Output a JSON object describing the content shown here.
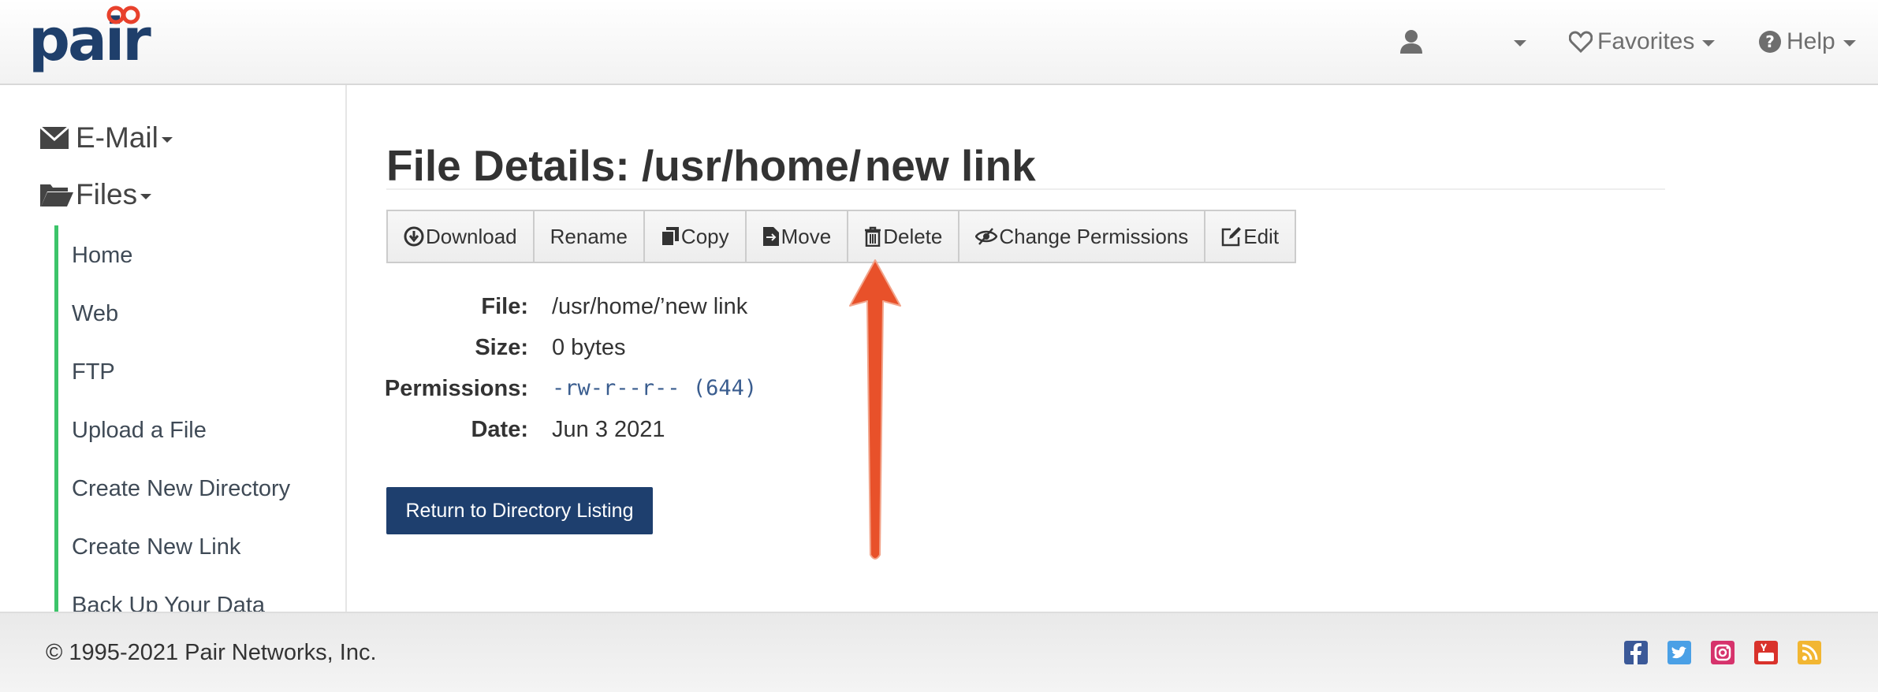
{
  "brand": {
    "name": "pair",
    "colors": {
      "navy": "#1f3f6b",
      "accent": "#e8412c",
      "green": "#3cc46a"
    }
  },
  "navbar": {
    "user_icon": "user-icon",
    "favorites_label": "Favorites",
    "help_label": "Help"
  },
  "sidebar": {
    "email_label": "E-Mail",
    "files_label": "Files",
    "items": [
      {
        "label": "Home"
      },
      {
        "label": "Web"
      },
      {
        "label": "FTP"
      },
      {
        "label": "Upload a File"
      },
      {
        "label": "Create New Directory"
      },
      {
        "label": "Create New Link"
      },
      {
        "label": "Back Up Your Data"
      }
    ]
  },
  "page": {
    "title": "File Details: /usr/home/ new link"
  },
  "toolbar": {
    "buttons": [
      {
        "label": "Download",
        "icon": "download-icon"
      },
      {
        "label": "Rename",
        "icon": ""
      },
      {
        "label": "Copy",
        "icon": "copy-icon"
      },
      {
        "label": "Move",
        "icon": "move-icon"
      },
      {
        "label": "Delete",
        "icon": "trash-icon"
      },
      {
        "label": "Change Permissions",
        "icon": "eye-slash-icon"
      },
      {
        "label": "Edit",
        "icon": "edit-icon"
      }
    ]
  },
  "details": {
    "file_label": "File:",
    "file_value": "/usr/home/’new link",
    "size_label": "Size:",
    "size_value": "0 bytes",
    "permissions_label": "Permissions:",
    "permissions_value": "-rw-r--r-- (644)",
    "date_label": "Date:",
    "date_value": "Jun 3 2021"
  },
  "return_button": {
    "label": "Return to Directory Listing"
  },
  "annotation": {
    "arrow_color": "#e8512a",
    "arrow_icon": "annotation-arrow"
  },
  "footer": {
    "copyright": "© 1995-2021 Pair Networks, Inc.",
    "social": [
      {
        "icon": "facebook-icon",
        "color": "#3b5998"
      },
      {
        "icon": "twitter-icon",
        "color": "#4aa0e6"
      },
      {
        "icon": "instagram-icon",
        "color": "#d6336c"
      },
      {
        "icon": "youtube-icon",
        "color": "#d9322b"
      },
      {
        "icon": "rss-icon",
        "color": "#f2b632"
      }
    ]
  }
}
